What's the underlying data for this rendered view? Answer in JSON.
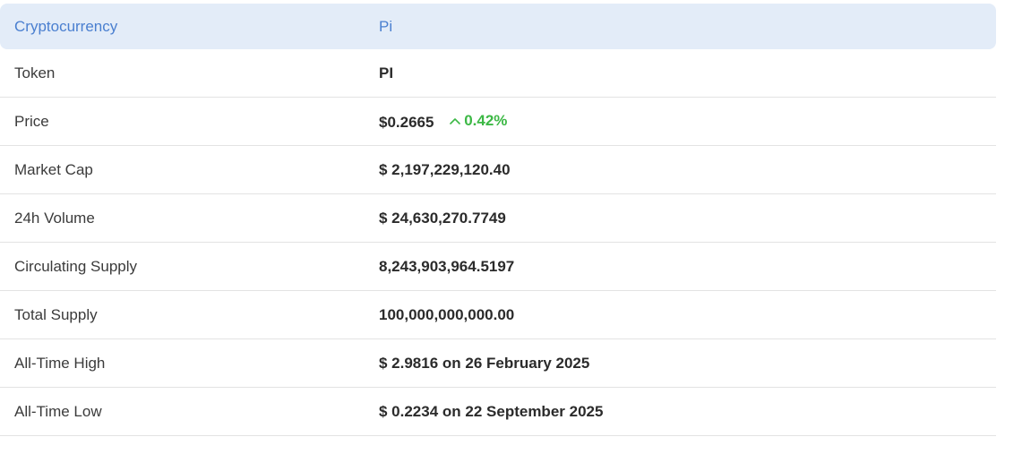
{
  "header": {
    "label": "Cryptocurrency",
    "value": "Pi"
  },
  "rows": [
    {
      "label": "Token",
      "value": "PI"
    },
    {
      "label": "Price",
      "value": "$0.2665",
      "change": "0.42%",
      "change_direction": "up",
      "change_color": "#3cb845"
    },
    {
      "label": "Market Cap",
      "value": "$ 2,197,229,120.40"
    },
    {
      "label": "24h Volume",
      "value": "$ 24,630,270.7749"
    },
    {
      "label": "Circulating Supply",
      "value": "8,243,903,964.5197"
    },
    {
      "label": "Total Supply",
      "value": "100,000,000,000.00"
    },
    {
      "label": "All-Time High",
      "value": "$ 2.9816 on 26 February 2025"
    },
    {
      "label": "All-Time Low",
      "value": "$ 0.2234 on 22 September 2025"
    }
  ],
  "colors": {
    "header_bg": "#e3ecf8",
    "header_text": "#4a7fd0",
    "positive": "#3cb845"
  },
  "icons": {
    "change": "chevron-up-icon"
  }
}
